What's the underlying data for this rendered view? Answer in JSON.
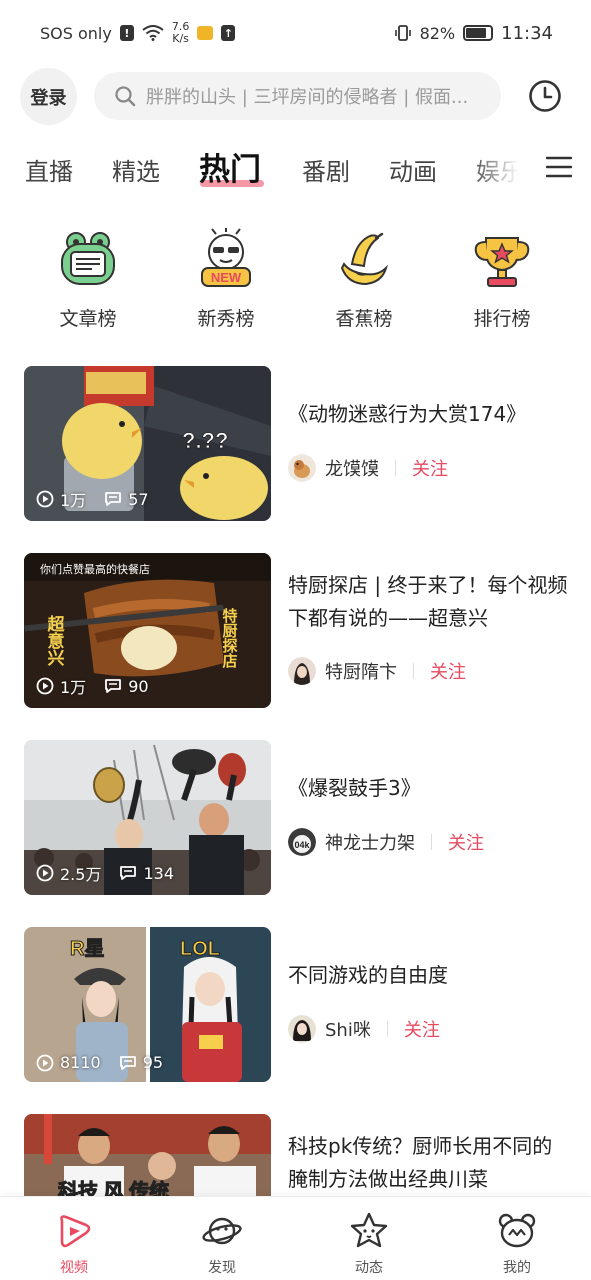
{
  "status_bar": {
    "carrier": "SOS only",
    "alert_badge": "!",
    "speed_value": "7.6",
    "speed_unit": "K/s",
    "battery": "82%",
    "battery_level": 0.82,
    "time": "11:34"
  },
  "header": {
    "login_label": "登录",
    "search_placeholder": "胖胖的山头 | 三坪房间的侵略者 | 假面..."
  },
  "tabs": [
    {
      "label": "直播",
      "active": false
    },
    {
      "label": "精选",
      "active": false
    },
    {
      "label": "热门",
      "active": true
    },
    {
      "label": "番剧",
      "active": false
    },
    {
      "label": "动画",
      "active": false
    },
    {
      "label": "娱乐",
      "active": false
    }
  ],
  "quick_entries": [
    {
      "label": "文章榜",
      "icon": "frog-article-icon"
    },
    {
      "label": "新秀榜",
      "icon": "new-face-icon",
      "badge": "NEW"
    },
    {
      "label": "香蕉榜",
      "icon": "banana-icon"
    },
    {
      "label": "排行榜",
      "icon": "trophy-icon"
    }
  ],
  "videos": [
    {
      "title": "《动物迷惑行为大赏174》",
      "views": "1万",
      "comments": "57",
      "author": "龙馍馍",
      "follow": "关注",
      "thumb_text": "?.??"
    },
    {
      "title": "特厨探店 | 终于来了！每个视频下都有说的——超意兴",
      "views": "1万",
      "comments": "90",
      "author": "特厨隋卞",
      "follow": "关注",
      "thumb_text": "你们点赞最高的快餐店",
      "thumb_side_left": "超意兴",
      "thumb_side_right": "特厨探店"
    },
    {
      "title": "《爆裂鼓手3》",
      "views": "2.5万",
      "comments": "134",
      "author": "神龙士力架",
      "follow": "关注",
      "avatar_text": "04k"
    },
    {
      "title": "不同游戏的自由度",
      "views": "8110",
      "comments": "95",
      "author": "Shi咪",
      "follow": "关注",
      "thumb_left_label": "R星",
      "thumb_right_label": "LOL"
    },
    {
      "title": "科技pk传统？厨师长用不同的腌制方法做出经典川菜",
      "thumb_text": "科技 风 传统"
    }
  ],
  "bottom_nav": [
    {
      "label": "视频",
      "icon": "video-play-icon",
      "active": true
    },
    {
      "label": "发现",
      "icon": "planet-icon",
      "active": false
    },
    {
      "label": "动态",
      "icon": "star-face-icon",
      "active": false
    },
    {
      "label": "我的",
      "icon": "bear-face-icon",
      "active": false
    }
  ],
  "colors": {
    "accent": "#e84a60",
    "tab_underline": "#f27d8f",
    "search_bg": "#f3f3f3"
  }
}
